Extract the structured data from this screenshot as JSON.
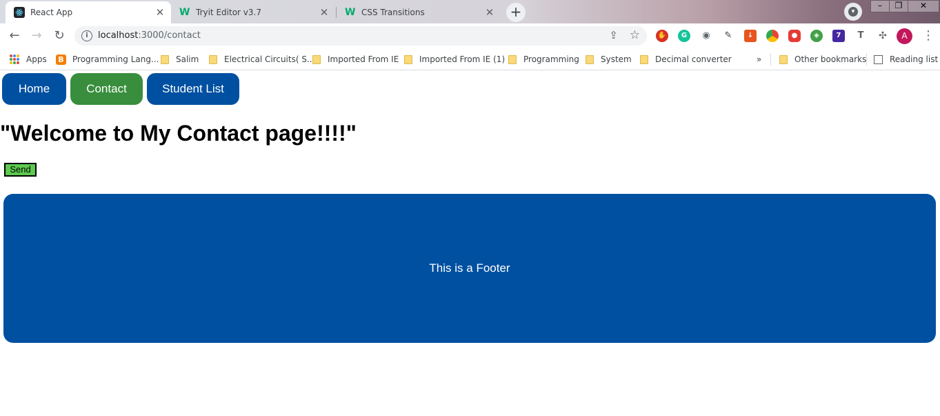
{
  "browser": {
    "tabs": [
      {
        "title": "React App",
        "icon": "react-icon",
        "active": true
      },
      {
        "title": "Tryit Editor v3.7",
        "icon": "w3schools-icon",
        "active": false
      },
      {
        "title": "CSS Transitions",
        "icon": "w3schools-icon",
        "active": false
      }
    ],
    "close_glyph": "✕",
    "new_tab_glyph": "+",
    "url_host": "localhost",
    "url_path": ":3000/contact",
    "profile_initial": "A",
    "extension_badge": "7",
    "bookmarks": [
      {
        "label": "Apps",
        "icon": "apps-grid-icon"
      },
      {
        "label": "Programming Lang...",
        "icon": "blogger-icon"
      },
      {
        "label": "Salim",
        "icon": "folder-icon"
      },
      {
        "label": "Electrical Circuits( S...",
        "icon": "folder-icon"
      },
      {
        "label": "Imported From IE",
        "icon": "folder-icon"
      },
      {
        "label": "Imported From IE (1)",
        "icon": "folder-icon"
      },
      {
        "label": "Programming",
        "icon": "folder-icon"
      },
      {
        "label": "System",
        "icon": "folder-icon"
      },
      {
        "label": "Decimal converter",
        "icon": "folder-icon"
      }
    ],
    "more_bookmarks_glyph": "»",
    "other_bookmarks": "Other bookmarks",
    "reading_list": "Reading list"
  },
  "page": {
    "nav": [
      {
        "label": "Home",
        "color": "#0050a1"
      },
      {
        "label": "Contact",
        "color": "#388e3c"
      },
      {
        "label": "Student List",
        "color": "#0050a1"
      }
    ],
    "heading": "\"Welcome to My Contact page!!!!\"",
    "send_label": "Send",
    "footer_text": "This is a Footer"
  },
  "colors": {
    "nav_blue": "#0050a1",
    "nav_green": "#388e3c",
    "send_green": "#5cc94f",
    "footer_bg": "#0050a1"
  }
}
